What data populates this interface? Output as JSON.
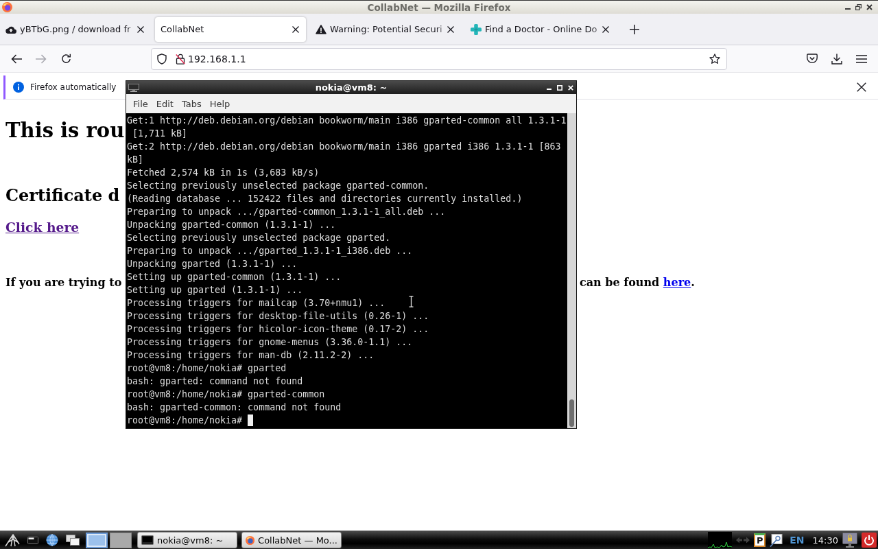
{
  "browser": {
    "title": "CollabNet — Mozilla Firefox",
    "tabs": [
      {
        "label": "yBTbG.png / download fr",
        "selected": false
      },
      {
        "label": "CollabNet",
        "selected": true
      },
      {
        "label": "Warning: Potential Securi",
        "selected": false
      },
      {
        "label": "Find a Doctor - Online Do",
        "selected": false
      }
    ],
    "navigation": {
      "back": {
        "disabled": false
      },
      "forward": {
        "disabled": true
      }
    },
    "address_bar": {
      "value": "192.168.1.1",
      "secure": false
    },
    "notification": {
      "text": "Firefox automatically"
    }
  },
  "page": {
    "heading": "This is rou",
    "subheading": "Certificate d",
    "link": {
      "text": "Click here",
      "visited": true
    },
    "note_left": "If you are trying to",
    "note_right": {
      "text": "can be found ",
      "link": {
        "text": "here",
        "visited": false
      },
      "end": "."
    }
  },
  "terminal": {
    "title": "nokia@vm8: ~",
    "menu": [
      "File",
      "Edit",
      "Tabs",
      "Help"
    ],
    "lines": [
      "Get:1 http://deb.debian.org/debian bookworm/main i386 gparted-common all 1.3.1-1",
      " [1,711 kB]",
      "Get:2 http://deb.debian.org/debian bookworm/main i386 gparted i386 1.3.1-1 [863",
      "kB]",
      "Fetched 2,574 kB in 1s (3,683 kB/s)",
      "Selecting previously unselected package gparted-common.",
      "(Reading database ... 152422 files and directories currently installed.)",
      "Preparing to unpack .../gparted-common_1.3.1-1_all.deb ...",
      "Unpacking gparted-common (1.3.1-1) ...",
      "Selecting previously unselected package gparted.",
      "Preparing to unpack .../gparted_1.3.1-1_i386.deb ...",
      "Unpacking gparted (1.3.1-1) ...",
      "Setting up gparted-common (1.3.1-1) ...",
      "Setting up gparted (1.3.1-1) ...",
      "Processing triggers for mailcap (3.70+nmu1) ...",
      "Processing triggers for desktop-file-utils (0.26-1) ...",
      "Processing triggers for hicolor-icon-theme (0.17-2) ...",
      "Processing triggers for gnome-menus (3.36.0-1.1) ...",
      "Processing triggers for man-db (2.11.2-2) ...",
      "root@vm8:/home/nokia# gparted",
      "bash: gparted: command not found",
      "root@vm8:/home/nokia# gparted-common",
      "bash: gparted-common: command not found",
      "root@vm8:/home/nokia#"
    ]
  },
  "taskbar": {
    "desktops": [
      {
        "selected": true
      },
      {
        "selected": false
      }
    ],
    "tasks": [
      {
        "label": "nokia@vm8: ~"
      },
      {
        "label": "CollabNet — Mo..."
      }
    ],
    "tray": {
      "clipboard": "P",
      "keyboard_layout": "EN",
      "clock": "14:30"
    }
  }
}
